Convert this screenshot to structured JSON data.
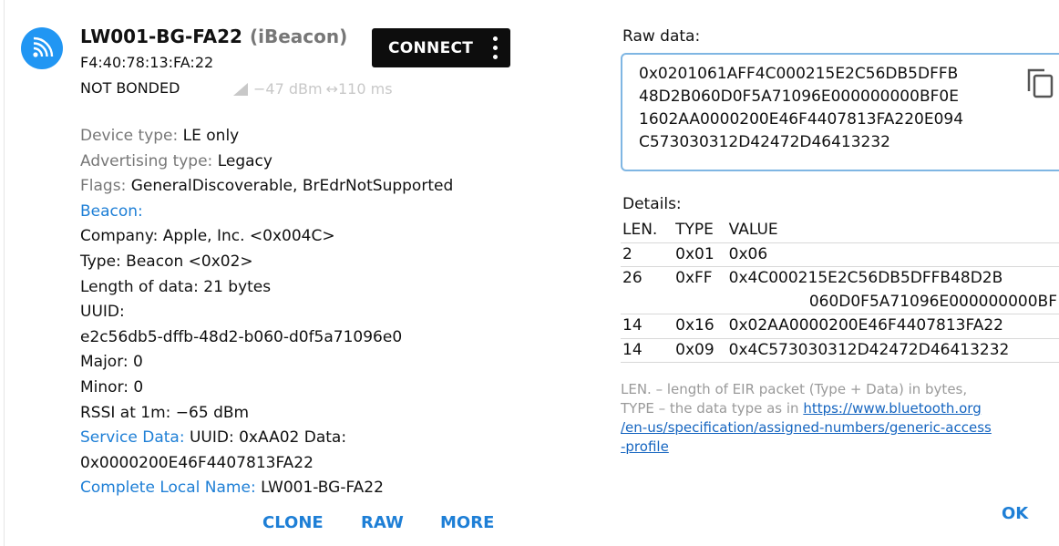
{
  "device": {
    "name": "LW001-BG-FA22",
    "type": "(iBeacon)",
    "mac": "F4:40:78:13:FA:22",
    "bond": "NOT BONDED",
    "rssi": "−47 dBm",
    "interval": "↔110 ms",
    "connect_label": "CONNECT"
  },
  "details": {
    "device_type_label": "Device type: ",
    "device_type_value": "LE only",
    "adv_type_label": "Advertising type: ",
    "adv_type_value": "Legacy",
    "flags_label": "Flags: ",
    "flags_value": "GeneralDiscoverable, BrEdrNotSupported",
    "beacon_label": "Beacon:",
    "company": "Company: Apple, Inc. <0x004C>",
    "type": "Type: Beacon <0x02>",
    "length": "Length of data: 21 bytes",
    "uuid_label": "UUID:",
    "uuid_value": "e2c56db5-dffb-48d2-b060-d0f5a71096e0",
    "major": "Major: 0",
    "minor": "Minor: 0",
    "rssi_1m": "RSSI at 1m: −65 dBm",
    "service_data_label": "Service Data: ",
    "service_data_value": "UUID: 0xAA02 Data:",
    "service_data_value2": "0x0000200E46F4407813FA22",
    "local_name_label": "Complete Local Name: ",
    "local_name_value": "LW001-BG-FA22"
  },
  "actions": {
    "clone": "CLONE",
    "raw": "RAW",
    "more": "MORE"
  },
  "raw": {
    "title": "Raw data:",
    "line1": "0x0201061AFF4C000215E2C56DB5DFFB",
    "line2": "48D2B060D0F5A71096E000000000BF0E",
    "line3": "1602AA0000200E46F4407813FA220E094",
    "line4": "C573030312D42472D46413232"
  },
  "table": {
    "title": "Details:",
    "headers": [
      "LEN.",
      "TYPE",
      "VALUE"
    ],
    "rows": [
      {
        "len": "2",
        "type": "0x01",
        "value": "0x06",
        "value2": ""
      },
      {
        "len": "26",
        "type": "0xFF",
        "value": "0x4C000215E2C56DB5DFFB48D2B",
        "value2": "060D0F5A71096E000000000BF"
      },
      {
        "len": "14",
        "type": "0x16",
        "value": "0x02AA0000200E46F4407813FA22",
        "value2": ""
      },
      {
        "len": "14",
        "type": "0x09",
        "value": "0x4C573030312D42472D46413232",
        "value2": ""
      }
    ]
  },
  "note": {
    "line1": "LEN. – length of EIR packet (Type + Data) in bytes,",
    "line2_prefix": "TYPE – the data type as in ",
    "link1": "https://www.bluetooth.org",
    "link2": "/en-us/specification/assigned-numbers/generic-access",
    "link3": "-profile"
  },
  "ok_label": "OK"
}
